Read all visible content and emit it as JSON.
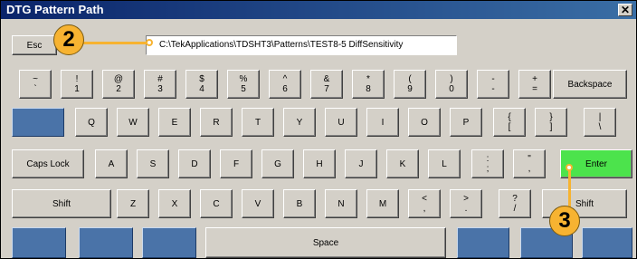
{
  "window": {
    "title": "DTG Pattern Path",
    "close_label": "✕"
  },
  "path_value": "C:\\TekApplications\\TDSHT3\\Patterns\\TEST8-5 DiffSensitivity",
  "keys": {
    "esc": "Esc",
    "row1": [
      {
        "t": "~",
        "b": "`"
      },
      {
        "t": "!",
        "b": "1"
      },
      {
        "t": "@",
        "b": "2"
      },
      {
        "t": "#",
        "b": "3"
      },
      {
        "t": "$",
        "b": "4"
      },
      {
        "t": "%",
        "b": "5"
      },
      {
        "t": "^",
        "b": "6"
      },
      {
        "t": "&",
        "b": "7"
      },
      {
        "t": "*",
        "b": "8"
      },
      {
        "t": "(",
        "b": "9"
      },
      {
        "t": ")",
        "b": "0"
      },
      {
        "t": "-",
        "b": "-"
      },
      {
        "t": "+",
        "b": "="
      }
    ],
    "backspace": "Backspace",
    "row2": [
      "Q",
      "W",
      "E",
      "R",
      "T",
      "Y",
      "U",
      "I",
      "O",
      "P"
    ],
    "row2_sym": [
      {
        "t": "{",
        "b": "["
      },
      {
        "t": "}",
        "b": "]"
      },
      {
        "t": "|",
        "b": "\\"
      }
    ],
    "caps_lock": "Caps Lock",
    "row3": [
      "A",
      "S",
      "D",
      "F",
      "G",
      "H",
      "J",
      "K",
      "L"
    ],
    "row3_sym": [
      {
        "t": ":",
        "b": ";"
      },
      {
        "t": "\"",
        "b": ","
      }
    ],
    "enter": "Enter",
    "shift_left": "Shift",
    "row4": [
      "Z",
      "X",
      "C",
      "V",
      "B",
      "N",
      "M"
    ],
    "row4_sym": [
      {
        "t": "<",
        "b": ","
      },
      {
        "t": ">",
        "b": "."
      },
      {
        "t": "?",
        "b": "/"
      }
    ],
    "shift_right": "Shift",
    "space": "Space"
  },
  "callouts": {
    "step_2": "2",
    "step_3": "3"
  },
  "colors": {
    "enter_key": "#4ce34c",
    "callout": "#f7b331",
    "blank_key": "#4a73a8"
  }
}
